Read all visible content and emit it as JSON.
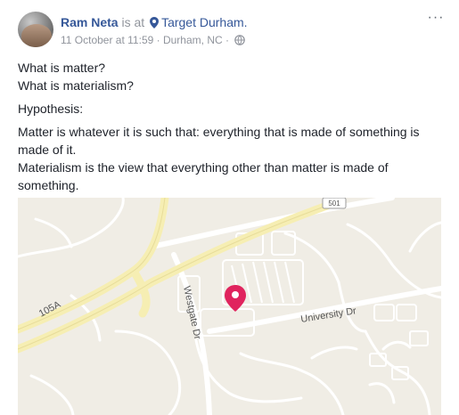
{
  "post": {
    "author": "Ram Neta",
    "is_at": "is at",
    "place": "Target Durham.",
    "timestamp": "11 October at 11:59",
    "location": "· Durham, NC ·",
    "more_label": "···",
    "paragraphs": [
      "What is matter?",
      "What is materialism?",
      "Hypothesis:",
      "Matter is whatever it is such that: everything that is made of something is made of it.",
      "Materialism is the view that everything other than matter is made of something."
    ]
  },
  "map": {
    "labels": {
      "highway_exit": "105A",
      "route_shield": "501",
      "street_westgate": "Westgate Dr",
      "street_university": "University Dr"
    },
    "pin_color": "#e0245e",
    "road_color": "#ffffff",
    "highway_color": "#f6eeb3",
    "land_color": "#f0ede5"
  },
  "icons": {
    "author_pin": "location-pin-icon",
    "privacy": "globe-icon",
    "map_marker": "map-marker-icon"
  }
}
